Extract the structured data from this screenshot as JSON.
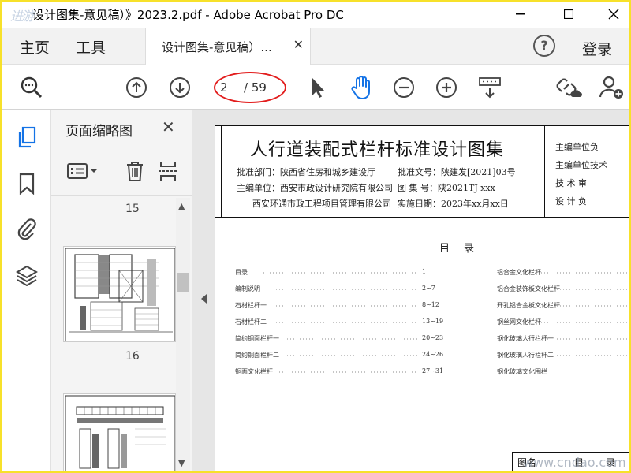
{
  "window": {
    "title": "设计图集-意见稿）》2023.2.pdf - Adobe Acrobat Pro DC",
    "logo_text": "进游网"
  },
  "tabs": {
    "home": "主页",
    "tools": "工具",
    "document": "设计图集-意见稿）...",
    "help": "?",
    "login": "登录"
  },
  "toolbar": {
    "current_page": "2",
    "total_pages": "/ 59"
  },
  "thumbnails_panel": {
    "title": "页面缩略图",
    "pages": [
      {
        "label": "15"
      },
      {
        "label": "16"
      }
    ]
  },
  "document": {
    "title": "人行道装配式栏杆标准设计图集",
    "meta_left": [
      "批准部门：陕西省住房和城乡建设厅",
      "主编单位：西安市政设计研究院有限公司",
      "西安环通市政工程项目管理有限公司"
    ],
    "meta_right": [
      "批准文号：陕建发[2021]03号",
      "图 集 号：陕2021TJ xxx",
      "实施日期：2023年xx月xx日"
    ],
    "side_labels": [
      "主编单位负",
      "主编单位技术",
      "技 术 审",
      "设 计 负"
    ],
    "toc_heading": "目录",
    "toc_left": [
      {
        "name": "目录",
        "page": "1"
      },
      {
        "name": "编制说明",
        "page": "2~7"
      },
      {
        "name": "石材栏杆一",
        "page": "8~12"
      },
      {
        "name": "石材栏杆二",
        "page": "13~19"
      },
      {
        "name": "简约铜面栏杆一",
        "page": "20~23"
      },
      {
        "name": "简约铜面栏杆二",
        "page": "24~26"
      },
      {
        "name": "铜面文化栏杆",
        "page": "27~31"
      }
    ],
    "toc_right": [
      "铝合金文化栏杆",
      "铝合金装饰板文化栏杆",
      "开孔铝合金板文化栏杆",
      "钢丝网文化栏杆",
      "钢化玻璃人行栏杆一",
      "钢化玻璃人行栏杆二",
      "钢化玻璃文化围栏"
    ],
    "footer_labels": [
      "图名",
      "目",
      "录"
    ]
  },
  "watermark": "www.cndao.com"
}
